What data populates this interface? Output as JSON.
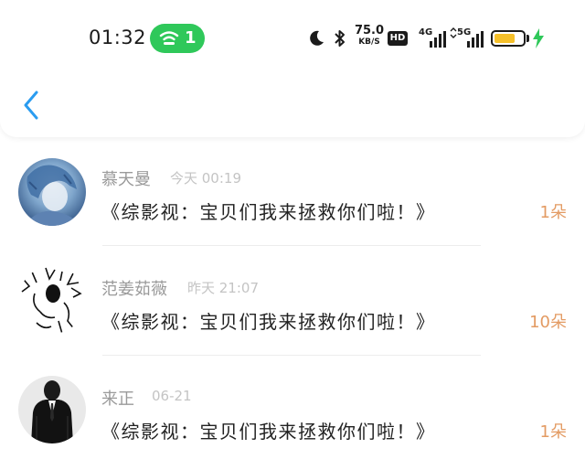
{
  "status_bar": {
    "time": "01:32",
    "hotspot_count": "1",
    "net_speed_value": "75.0",
    "net_speed_unit": "KB/S",
    "hd_label": "HD",
    "sim1_label": "4G",
    "sim2_label": "5G",
    "battery_level": 0.6,
    "battery_color": "#f5c02a",
    "accent_green": "#2fc85a"
  },
  "nav": {
    "back_icon": "chevron-left-icon",
    "back_color": "#2a9cf0"
  },
  "items": [
    {
      "user": "慕天曼",
      "time": "今天 00:19",
      "title": "《综影视：宝贝们我来拯救你们啦！》",
      "count": "1朵"
    },
    {
      "user": "范姜茹薇",
      "time": "昨天 21:07",
      "title": "《综影视：宝贝们我来拯救你们啦！》",
      "count": "10朵"
    },
    {
      "user": "来正",
      "time": "06-21",
      "title": "《综影视：宝贝们我来拯救你们啦！》",
      "count": "1朵"
    }
  ]
}
